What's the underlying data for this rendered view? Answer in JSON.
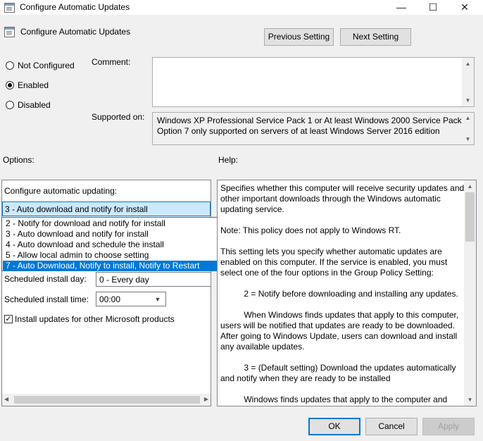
{
  "window": {
    "title": "Configure Automatic Updates",
    "minimize": "—",
    "maximize": "☐",
    "close": "✕"
  },
  "header": {
    "title": "Configure Automatic Updates",
    "prev_label": "Previous Setting",
    "next_label": "Next Setting"
  },
  "state": {
    "not_configured": "Not Configured",
    "enabled": "Enabled",
    "disabled": "Disabled",
    "selected": "enabled"
  },
  "comment": {
    "label": "Comment:",
    "value": ""
  },
  "supported": {
    "label": "Supported on:",
    "lines": [
      "Windows XP Professional Service Pack 1 or At least Windows 2000 Service Pack 3",
      "Option 7 only supported on servers of at least Windows Server 2016 edition"
    ]
  },
  "options": {
    "label": "Options:",
    "configure_label": "Configure automatic updating:",
    "selected_value": "3 - Auto download and notify for install",
    "dropdown_items": [
      "2 - Notify for download and notify for install",
      "3 - Auto download and notify for install",
      "4 - Auto download and schedule the install",
      "5 - Allow local admin to choose setting",
      "7 - Auto Download, Notify to install, Notify to Restart"
    ],
    "highlighted_index": 4,
    "schedule_day_label": "Scheduled install day:",
    "schedule_day_value": "0 - Every day",
    "schedule_time_label": "Scheduled install time:",
    "schedule_time_value": "00:00",
    "other_products_label": "Install updates for other Microsoft products",
    "other_products_checked": true
  },
  "help": {
    "label": "Help:",
    "lines": [
      "Specifies whether this computer will receive security updates and",
      "other important downloads through the Windows automatic",
      "updating service.",
      "",
      "Note: This policy does not apply to Windows RT.",
      "",
      "This setting lets you specify whether automatic updates are",
      "enabled on this computer. If the service is enabled, you must",
      "select one of the four options in the Group Policy Setting:",
      "",
      "          2 = Notify before downloading and installing any updates.",
      "",
      "          When Windows finds updates that apply to this computer,",
      "users will be notified that updates are ready to be downloaded.",
      "After going to Windows Update, users can download and install",
      "any available updates.",
      "",
      "          3 = (Default setting) Download the updates automatically",
      "and notify when they are ready to be installed",
      "",
      "          Windows finds updates that apply to the computer and"
    ]
  },
  "footer": {
    "ok": "OK",
    "cancel": "Cancel",
    "apply": "Apply"
  }
}
